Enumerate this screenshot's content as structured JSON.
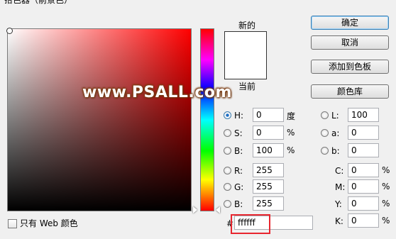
{
  "title": "拾色器（前景色）",
  "swatches": {
    "new_label": "新的",
    "current_label": "当前",
    "new_color": "#ffffff",
    "current_color": "#ffffff"
  },
  "watermark": "www.PSALL.com",
  "buttons": {
    "ok": "确定",
    "cancel": "取消",
    "add_to_swatches": "添加到色板",
    "color_libraries": "颜色库"
  },
  "hsb": [
    {
      "key": "h",
      "label": "H:",
      "value": "0",
      "unit": "度",
      "checked": true
    },
    {
      "key": "s",
      "label": "S:",
      "value": "0",
      "unit": "%",
      "checked": false
    },
    {
      "key": "b",
      "label": "B:",
      "value": "100",
      "unit": "%",
      "checked": false
    }
  ],
  "rgb": [
    {
      "key": "r",
      "label": "R:",
      "value": "255"
    },
    {
      "key": "g",
      "label": "G:",
      "value": "255"
    },
    {
      "key": "b",
      "label": "B:",
      "value": "255"
    }
  ],
  "lab": [
    {
      "key": "l",
      "label": "L:",
      "value": "100"
    },
    {
      "key": "a",
      "label": "a:",
      "value": "0"
    },
    {
      "key": "b",
      "label": "b:",
      "value": "0"
    }
  ],
  "cmyk": [
    {
      "key": "c",
      "label": "C:",
      "value": "0",
      "unit": "%"
    },
    {
      "key": "m",
      "label": "M:",
      "value": "0",
      "unit": "%"
    },
    {
      "key": "y",
      "label": "Y:",
      "value": "0",
      "unit": "%"
    },
    {
      "key": "k",
      "label": "K:",
      "value": "0",
      "unit": "%"
    }
  ],
  "hex": {
    "prefix": "#",
    "value": "ffffff"
  },
  "web_colors_only": {
    "label": "只有 Web 颜色",
    "checked": false
  },
  "colors": {
    "accent": "#3c7fb1",
    "highlight_box": "#e8262f"
  }
}
